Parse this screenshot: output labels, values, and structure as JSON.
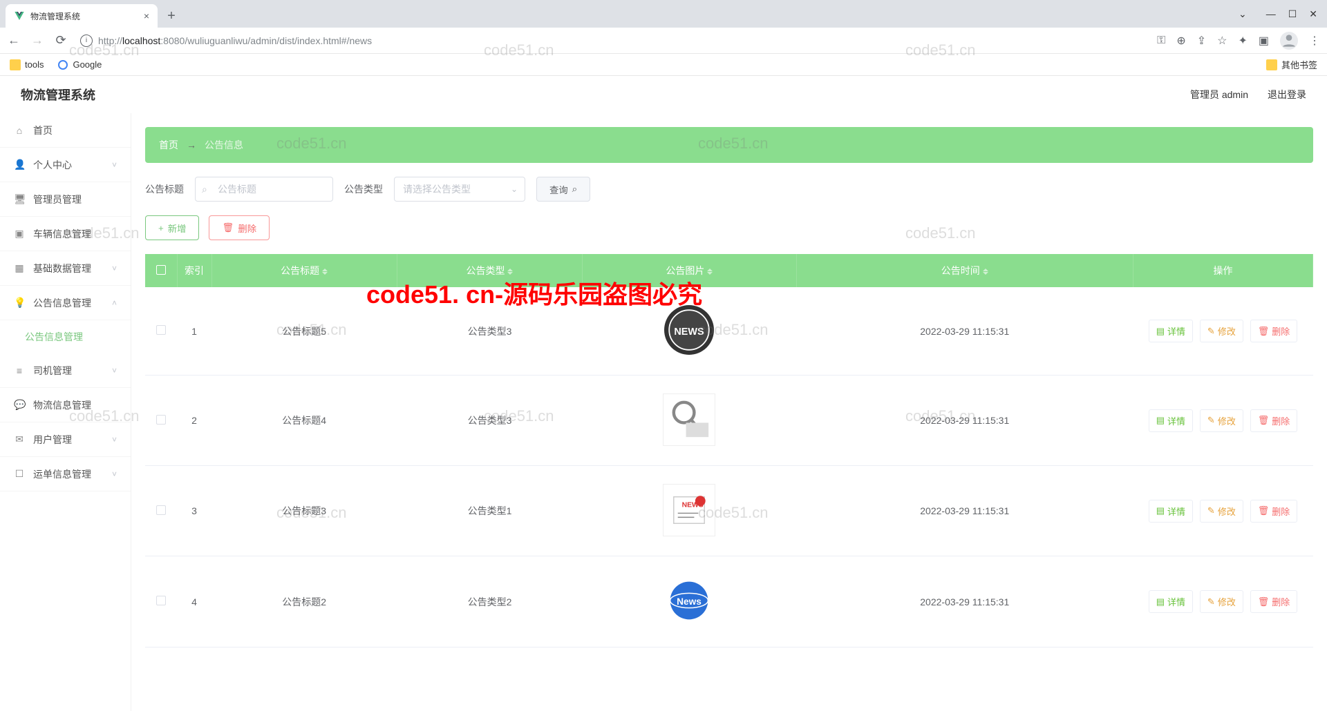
{
  "browser": {
    "tab_title": "物流管理系统",
    "url_host": "localhost",
    "url_port": ":8080",
    "url_path": "/wuliuguanliwu/admin/dist/index.html#/news",
    "bookmarks": {
      "tools": "tools",
      "google": "Google",
      "other": "其他书签"
    }
  },
  "header": {
    "title": "物流管理系统",
    "user_label": "管理员 admin",
    "logout": "退出登录"
  },
  "sidebar": [
    {
      "icon": "home",
      "label": "首页",
      "expandable": false
    },
    {
      "icon": "user",
      "label": "个人中心",
      "expandable": true
    },
    {
      "icon": "admin",
      "label": "管理员管理",
      "expandable": false
    },
    {
      "icon": "car",
      "label": "车辆信息管理",
      "expandable": false
    },
    {
      "icon": "grid",
      "label": "基础数据管理",
      "expandable": true
    },
    {
      "icon": "bulb",
      "label": "公告信息管理",
      "expandable": true,
      "open": true,
      "children": [
        "公告信息管理"
      ]
    },
    {
      "icon": "driver",
      "label": "司机管理",
      "expandable": true
    },
    {
      "icon": "msg",
      "label": "物流信息管理",
      "expandable": false
    },
    {
      "icon": "mail",
      "label": "用户管理",
      "expandable": true
    },
    {
      "icon": "order",
      "label": "运单信息管理",
      "expandable": true
    }
  ],
  "breadcrumb": {
    "home": "首页",
    "current": "公告信息"
  },
  "search": {
    "title_label": "公告标题",
    "title_placeholder": "公告标题",
    "type_label": "公告类型",
    "type_placeholder": "请选择公告类型",
    "query_btn": "查询",
    "add_btn": "新增",
    "del_btn": "删除"
  },
  "table": {
    "cols": [
      "",
      "索引",
      "公告标题",
      "公告类型",
      "公告图片",
      "公告时间",
      "操作"
    ],
    "op_labels": {
      "detail": "详情",
      "edit": "修改",
      "delete": "删除"
    },
    "rows": [
      {
        "idx": "1",
        "title": "公告标题5",
        "type": "公告类型3",
        "img": "news-globe",
        "time": "2022-03-29 11:15:31"
      },
      {
        "idx": "2",
        "title": "公告标题4",
        "type": "公告类型3",
        "img": "news-magnifier",
        "time": "2022-03-29 11:15:31"
      },
      {
        "idx": "3",
        "title": "公告标题3",
        "type": "公告类型1",
        "img": "news-card",
        "time": "2022-03-29 11:15:31"
      },
      {
        "idx": "4",
        "title": "公告标题2",
        "type": "公告类型2",
        "img": "news-globe2",
        "time": "2022-03-29 11:15:31"
      }
    ]
  },
  "watermarks": {
    "text": "code51.cn",
    "red": "code51. cn-源码乐园盗图必究"
  }
}
